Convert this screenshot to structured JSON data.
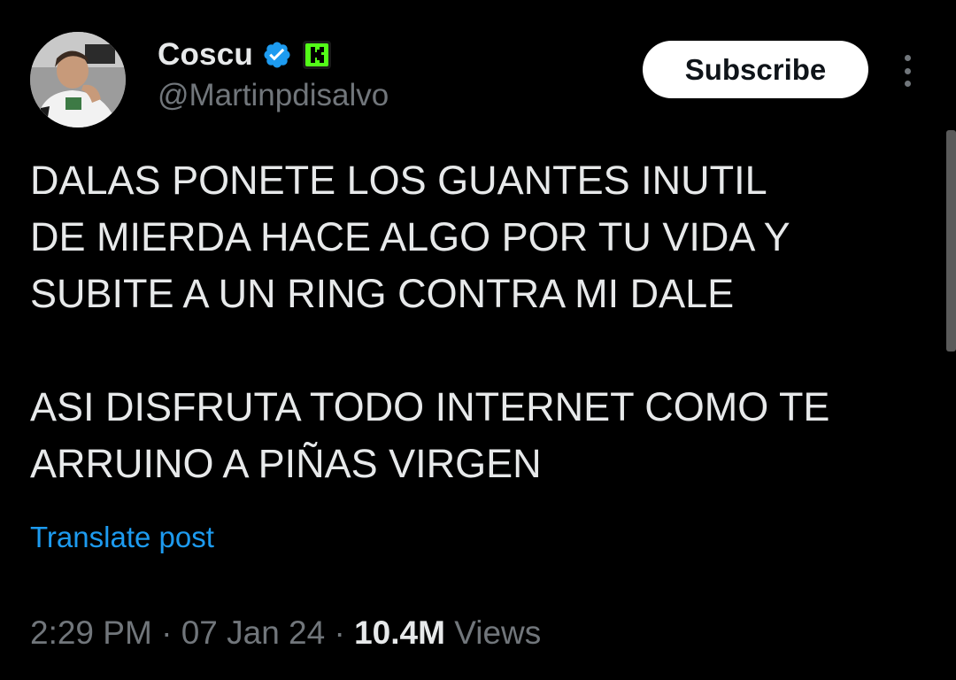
{
  "author": {
    "display_name": "Coscu",
    "handle": "@Martinpdisalvo",
    "verified_icon": "verified-badge-icon",
    "affiliate_icon": "kick-logo-icon"
  },
  "actions": {
    "subscribe_label": "Subscribe",
    "more_icon": "more-vertical-icon"
  },
  "post": {
    "lines": [
      "DALAS PONETE LOS GUANTES INUTIL",
      "DE MIERDA HACE ALGO POR TU VIDA Y",
      "SUBITE A UN RING CONTRA MI DALE",
      "",
      "ASI DISFRUTA TODO INTERNET COMO TE",
      "ARRUINO A PIÑAS VIRGEN"
    ],
    "translate_label": "Translate post"
  },
  "meta": {
    "time": "2:29 PM",
    "separator": "·",
    "date": "07 Jan 24",
    "views_count": "10.4M",
    "views_label": "Views"
  },
  "colors": {
    "background": "#000000",
    "text_primary": "#e7e9ea",
    "text_secondary": "#71767b",
    "link": "#1d9bf0",
    "verified": "#1d9bf0",
    "kick_green": "#53fc18",
    "button_bg": "#ffffff",
    "button_text": "#0f1419"
  }
}
